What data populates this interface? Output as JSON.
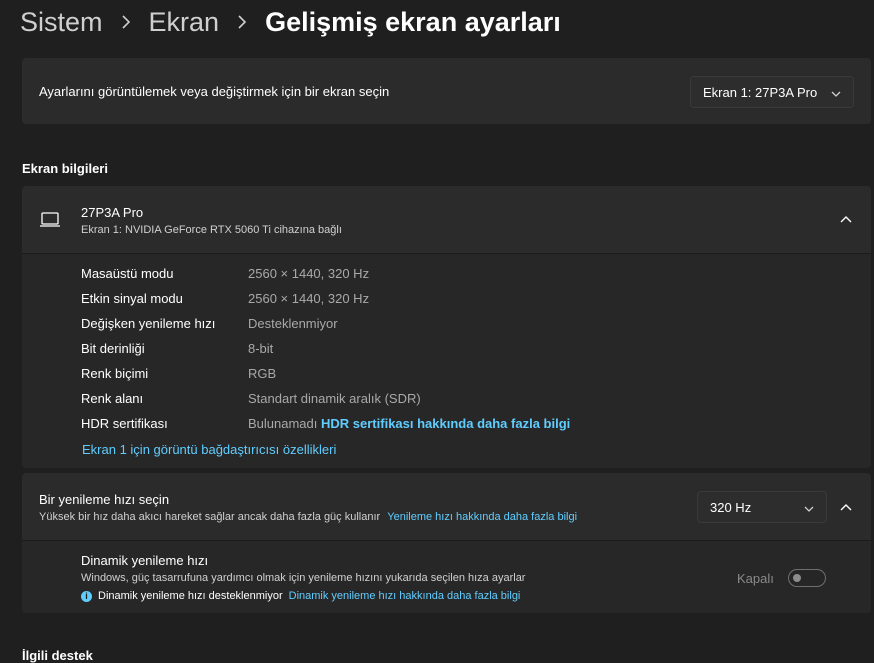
{
  "breadcrumb": {
    "items": [
      "Sistem",
      "Ekran"
    ],
    "current": "Gelişmiş ekran ayarları"
  },
  "display_select": {
    "label": "Ayarlarını görüntülemek veya değiştirmek için bir ekran seçin",
    "value": "Ekran 1: 27P3A Pro"
  },
  "info_section": {
    "heading": "Ekran bilgileri",
    "monitor_name": "27P3A Pro",
    "monitor_sub": "Ekran 1: NVIDIA GeForce RTX 5060 Ti cihazına bağlı",
    "rows": [
      {
        "label": "Masaüstü modu",
        "value": "2560 × 1440, 320 Hz"
      },
      {
        "label": "Etkin sinyal modu",
        "value": "2560 × 1440, 320 Hz"
      },
      {
        "label": "Değişken yenileme hızı",
        "value": "Desteklenmiyor"
      },
      {
        "label": "Bit derinliği",
        "value": "8-bit"
      },
      {
        "label": "Renk biçimi",
        "value": "RGB"
      },
      {
        "label": "Renk alanı",
        "value": "Standart dinamik aralık (SDR)"
      },
      {
        "label": "HDR sertifikası",
        "value": "Bulunamadı"
      }
    ],
    "hdr_link": "HDR sertifikası hakkında daha fazla bilgi",
    "adapter_link": "Ekran 1 için görüntü bağdaştırıcısı özellikleri"
  },
  "refresh": {
    "title": "Bir yenileme hızı seçin",
    "subtitle": "Yüksek bir hız daha akıcı hareket sağlar ancak daha fazla güç kullanır",
    "link": "Yenileme hızı hakkında daha fazla bilgi",
    "value": "320 Hz"
  },
  "dynamic": {
    "title": "Dinamik yenileme hızı",
    "description": "Windows, güç tasarrufuna yardımcı olmak için yenileme hızını yukarıda seçilen hıza ayarlar",
    "note": "Dinamik yenileme hızı desteklenmiyor",
    "link": "Dinamik yenileme hızı hakkında daha fazla bilgi",
    "toggle_label": "Kapalı",
    "toggle_on": false
  },
  "related": {
    "heading": "İlgili destek"
  },
  "colors": {
    "background": "#1f1f1f",
    "card": "#2b2b2b",
    "accent_link": "#60cdff"
  }
}
